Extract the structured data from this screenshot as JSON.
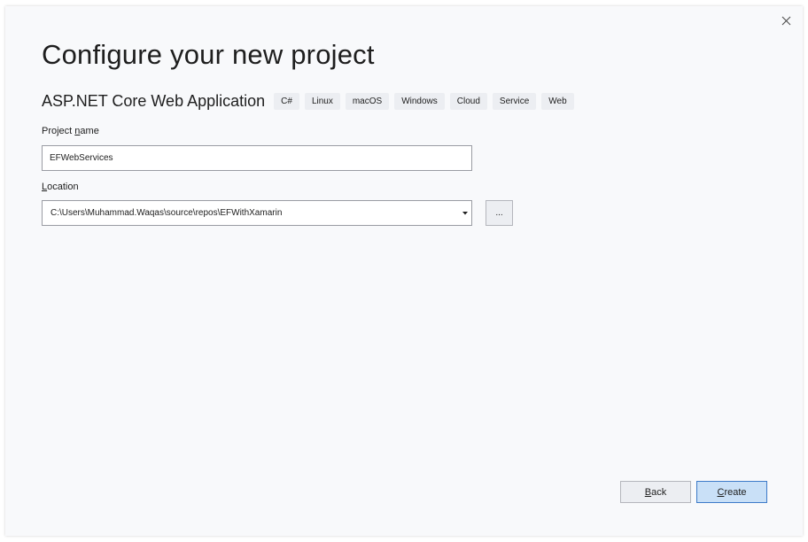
{
  "dialog": {
    "title": "Configure your new project",
    "close_icon": "close-icon"
  },
  "template": {
    "name": "ASP.NET Core Web Application",
    "tags": [
      "C#",
      "Linux",
      "macOS",
      "Windows",
      "Cloud",
      "Service",
      "Web"
    ]
  },
  "project_name": {
    "label_mnemonic_before": "Project ",
    "label_mnemonic": "n",
    "label_mnemonic_after": "ame",
    "value": "EFWebServices"
  },
  "location": {
    "label_mnemonic": "L",
    "label_mnemonic_after": "ocation",
    "value": "C:\\Users\\Muhammad.Waqas\\source\\repos\\EFWithXamarin",
    "dropdown_icon": "dropdown-arrow-icon",
    "browse_label": "..."
  },
  "buttons": {
    "back_mnemonic": "B",
    "back_rest": "ack",
    "create_mnemonic": "C",
    "create_rest": "reate"
  },
  "colors": {
    "dialog_background": "#f8f9fb",
    "tag_background": "#eceef2",
    "primary_button_background": "#c9e0f7",
    "primary_button_border": "#3d7ac8",
    "input_border": "#9a9ca3"
  }
}
